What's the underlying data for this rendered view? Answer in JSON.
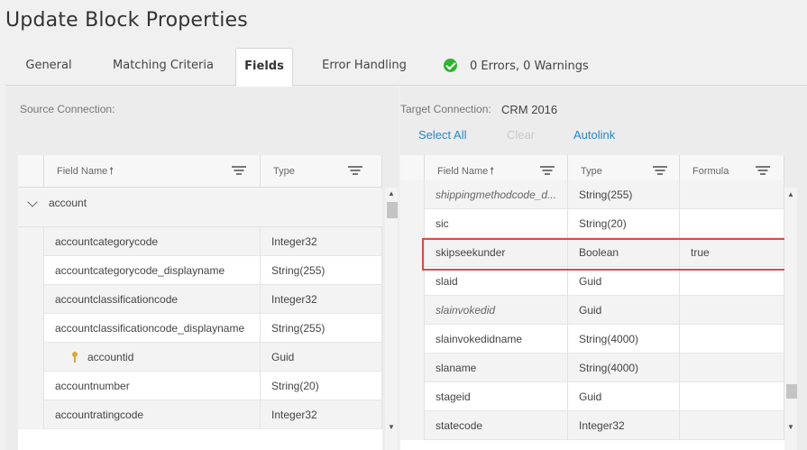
{
  "title": "Update Block Properties",
  "tabs": [
    {
      "label": "General"
    },
    {
      "label": "Matching Criteria"
    },
    {
      "label": "Fields"
    },
    {
      "label": "Error Handling"
    }
  ],
  "status_text": "0 Errors, 0 Warnings",
  "source": {
    "connection_label": "Source Connection:",
    "columns": {
      "field_name": "Field Name",
      "type": "Type"
    },
    "group_label": "account",
    "rows": [
      {
        "name": "accountcategorycode",
        "type": "Integer32"
      },
      {
        "name": "accountcategorycode_displayname",
        "type": "String(255)"
      },
      {
        "name": "accountclassificationcode",
        "type": "Integer32"
      },
      {
        "name": "accountclassificationcode_displayname",
        "type": "String(255)"
      },
      {
        "name": "accountid",
        "type": "Guid",
        "key": true
      },
      {
        "name": "accountnumber",
        "type": "String(20)"
      },
      {
        "name": "accountratingcode",
        "type": "Integer32"
      }
    ]
  },
  "target": {
    "connection_label": "Target Connection:",
    "connection_value": "CRM 2016",
    "actions": {
      "select_all": "Select All",
      "clear": "Clear",
      "autolink": "Autolink"
    },
    "columns": {
      "field_name": "Field Name",
      "type": "Type",
      "formula": "Formula"
    },
    "rows": [
      {
        "name": "shippingmethodcode_d...",
        "type": "String(255)",
        "formula": "",
        "italic": true
      },
      {
        "name": "sic",
        "type": "String(20)",
        "formula": ""
      },
      {
        "name": "skipseekunder",
        "type": "Boolean",
        "formula": "true",
        "highlighted": true
      },
      {
        "name": "slaid",
        "type": "Guid",
        "formula": ""
      },
      {
        "name": "slainvokedid",
        "type": "Guid",
        "formula": "",
        "italic": true
      },
      {
        "name": "slainvokedidname",
        "type": "String(4000)",
        "formula": ""
      },
      {
        "name": "slaname",
        "type": "String(4000)",
        "formula": ""
      },
      {
        "name": "stageid",
        "type": "Guid",
        "formula": ""
      },
      {
        "name": "statecode",
        "type": "Integer32",
        "formula": ""
      }
    ]
  },
  "colors": {
    "accent": "#2a87c8",
    "success": "#2db52d",
    "highlight": "#e04848"
  }
}
